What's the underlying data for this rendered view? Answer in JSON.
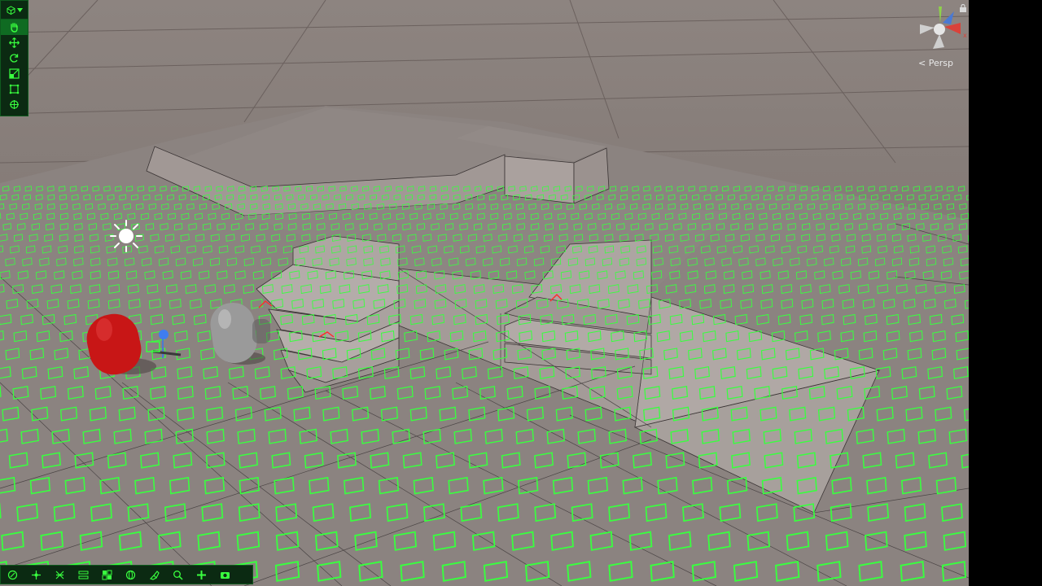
{
  "scene_view": {
    "projection_label": "< Persp",
    "ground_color": "#7a706d",
    "highlight_color": "#39ff3f",
    "selection_color": "#ff2a2a",
    "objects": [
      {
        "name": "red-capsule",
        "color": "#c81616"
      },
      {
        "name": "gray-capsule",
        "color": "#9a9a9a"
      },
      {
        "name": "directional-light-icon",
        "color": "#ffffff"
      }
    ]
  },
  "tool_strip": {
    "header_icons": [
      "cube-icon",
      "chevron-down-icon"
    ],
    "tools": [
      "hand-tool-icon",
      "move-tool-icon",
      "rotate-tool-icon",
      "scale-tool-icon",
      "rect-tool-icon",
      "transform-tool-icon"
    ]
  },
  "bottom_strip": {
    "tools": [
      "pivot-icon",
      "move-snap-icon",
      "grid-icon",
      "layers-icon",
      "tile-icon",
      "globe-icon",
      "paint-icon",
      "search-icon",
      "add-icon",
      "camera-icon"
    ]
  },
  "gizmo": {
    "axis_colors": {
      "x": "#d9423a",
      "y": "#8ed24a",
      "z": "#4a79d2"
    },
    "lock_icon": "lock-icon"
  }
}
